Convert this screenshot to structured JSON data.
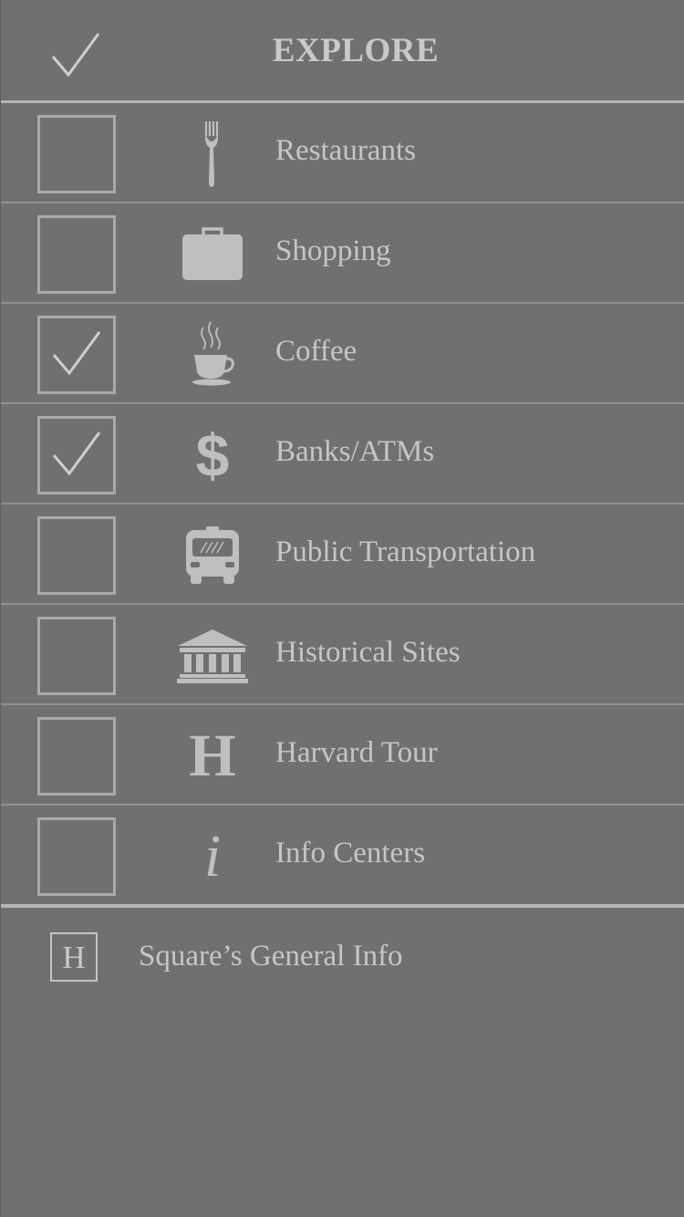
{
  "header": {
    "title": "EXPLORE",
    "check_icon": "checkmark-icon"
  },
  "categories": [
    {
      "label": "Restaurants",
      "icon": "fork-icon",
      "checked": false
    },
    {
      "label": "Shopping",
      "icon": "briefcase-icon",
      "checked": false
    },
    {
      "label": "Coffee",
      "icon": "coffee-cup-icon",
      "checked": true
    },
    {
      "label": "Banks/ATMs",
      "icon": "dollar-sign-icon",
      "checked": true
    },
    {
      "label": "Public Transportation",
      "icon": "bus-icon",
      "checked": false
    },
    {
      "label": "Historical Sites",
      "icon": "columns-building-icon",
      "checked": false
    },
    {
      "label": "Harvard Tour",
      "icon": "letter-h-icon",
      "glyph": "H",
      "checked": false
    },
    {
      "label": "Info Centers",
      "icon": "info-i-icon",
      "glyph": "i",
      "checked": false
    }
  ],
  "general_info": {
    "badge": "H",
    "label": "Square’s General Info"
  },
  "dollar_glyph": "$",
  "colors": {
    "background": "#6f706f",
    "text": "#c6c6c6",
    "divider": "#8f908f",
    "checkbox_border": "#a9aaa9",
    "icon": "#bfbfbf"
  }
}
